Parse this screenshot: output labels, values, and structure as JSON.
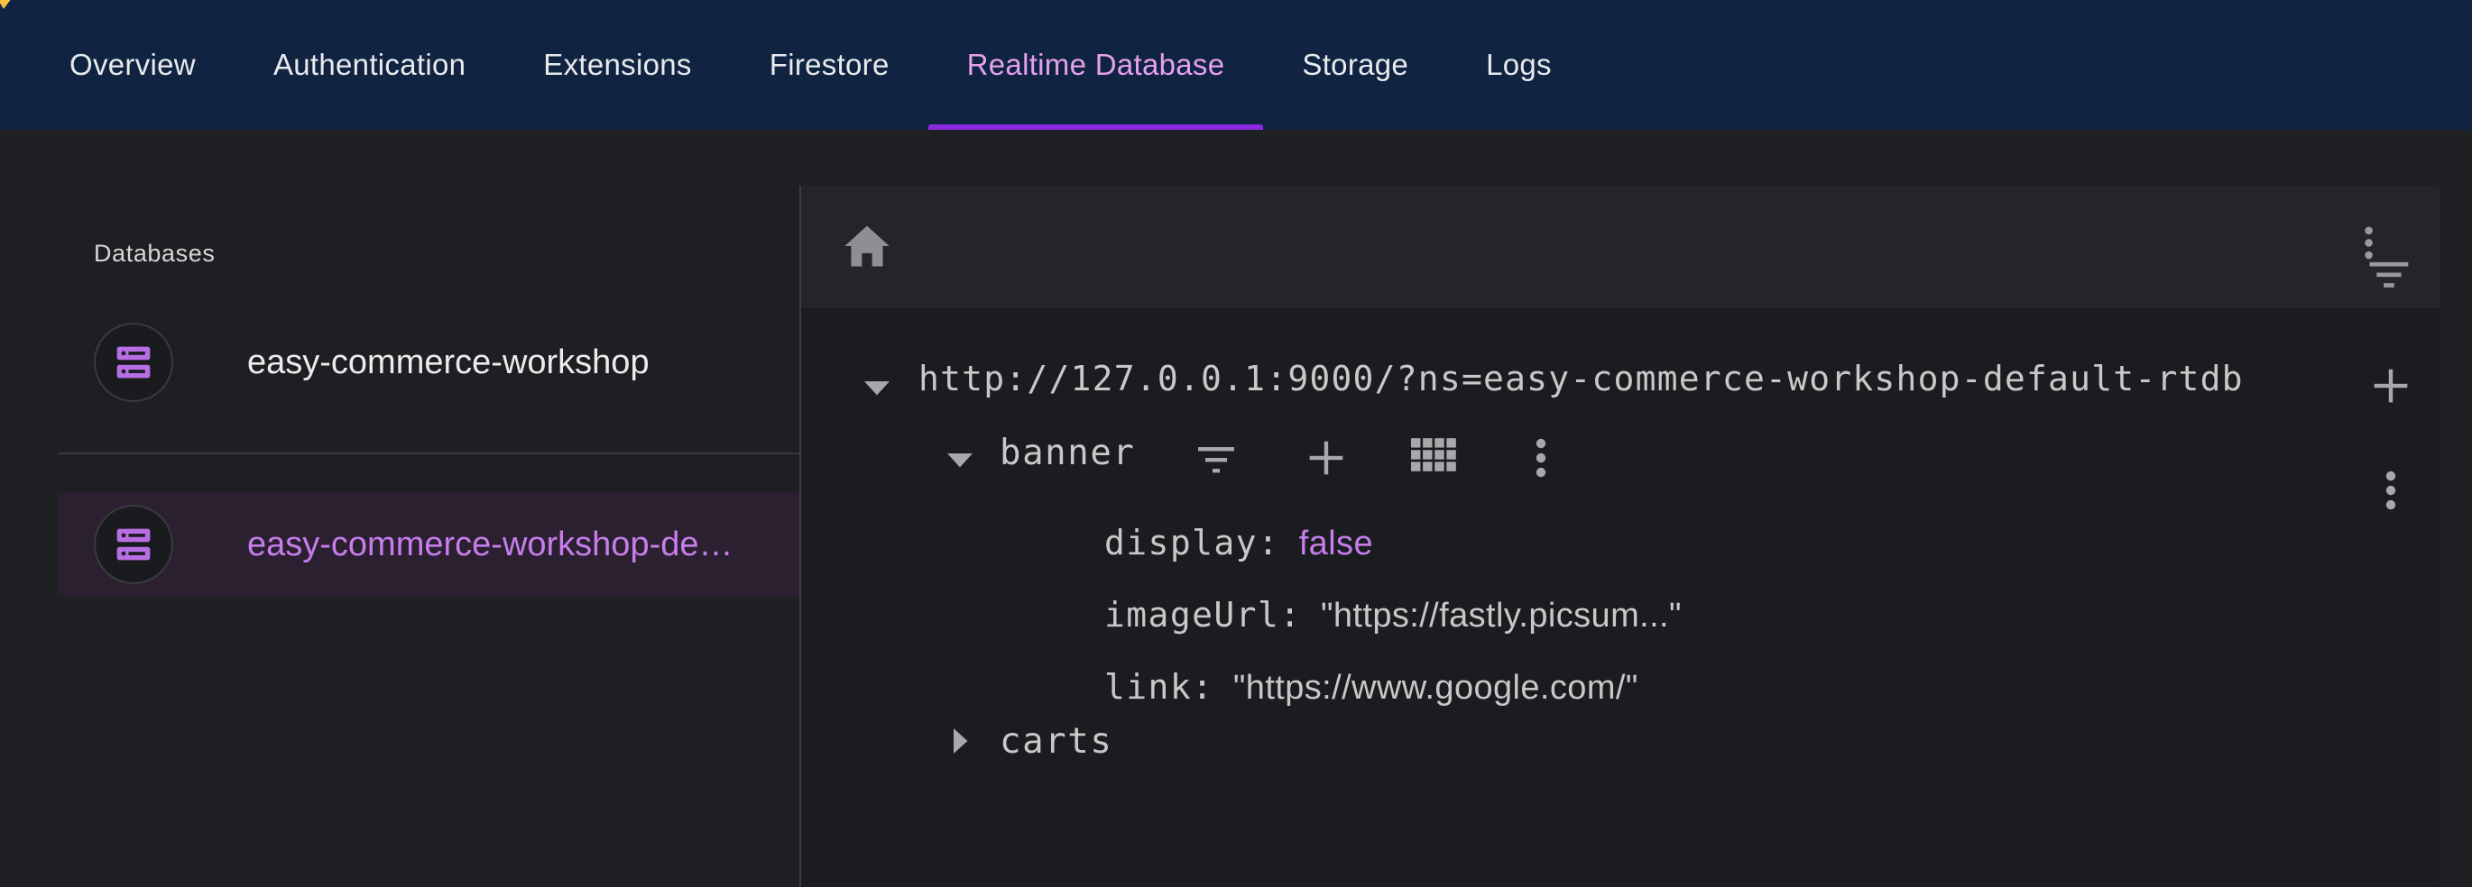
{
  "nav": {
    "tabs": [
      {
        "label": "Overview"
      },
      {
        "label": "Authentication"
      },
      {
        "label": "Extensions"
      },
      {
        "label": "Firestore"
      },
      {
        "label": "Realtime Database"
      },
      {
        "label": "Storage"
      },
      {
        "label": "Logs"
      }
    ],
    "active_tab": "Realtime Database"
  },
  "databases": {
    "heading": "Databases",
    "items": [
      {
        "label": "easy-commerce-workshop",
        "icon": "database-icon",
        "selected": false
      },
      {
        "label": "easy-commerce-workshop-de…",
        "icon": "database-icon",
        "selected": true
      }
    ]
  },
  "viewer": {
    "header_icons": [
      "home-icon",
      "filter-menu-icon"
    ],
    "root_url": "http://127.0.0.1:9000/?ns=easy-commerce-workshop-default-rtdb",
    "nodes": [
      {
        "key": "banner",
        "expanded": true,
        "actions": [
          "filter-icon",
          "add-icon",
          "grid-icon",
          "more-vert-icon"
        ],
        "children": [
          {
            "key": "display",
            "sep": ": ",
            "value": "false",
            "type": "boolean"
          },
          {
            "key": "imageUrl",
            "sep": ": ",
            "value": "\"https://fastly.picsum...\"",
            "type": "string"
          },
          {
            "key": "link",
            "sep": ": ",
            "value": "\"https://www.google.com/\"",
            "type": "string"
          }
        ]
      },
      {
        "key": "carts",
        "expanded": false
      }
    ]
  },
  "colors": {
    "nav_bg": "#102441",
    "page_bg": "#1f2023",
    "accent": "#c77dec",
    "active_tab_text": "#e6a0ee",
    "active_underline": "#8a2be2",
    "text": "#e8eaed"
  }
}
